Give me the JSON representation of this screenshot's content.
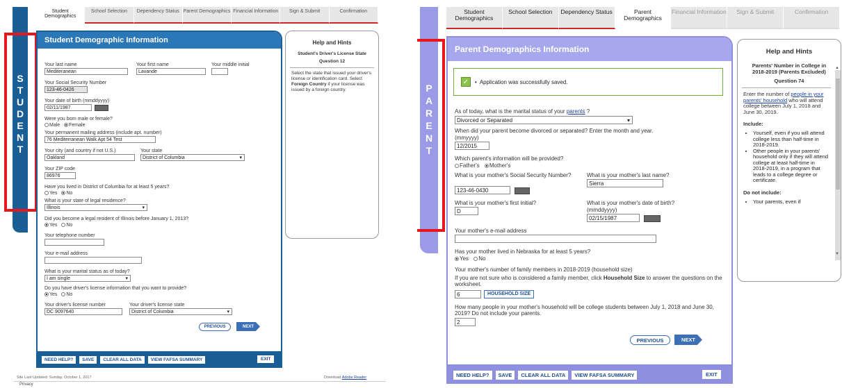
{
  "tabs": [
    "Student Demographics",
    "School Selection",
    "Dependency Status",
    "Parent Demographics",
    "Financial Information",
    "Sign & Submit",
    "Confirmation"
  ],
  "student": {
    "strip_letters": [
      "S",
      "T",
      "U",
      "D",
      "E",
      "N",
      "T"
    ],
    "panel_title": "Student Demographic Information",
    "last_name_label": "Your last name",
    "last_name": "Mediteranean",
    "first_name_label": "Your first name",
    "first_name": "Lavande",
    "mi_label": "Your middle initial",
    "ssn_label": "Your Social Security Number",
    "ssn": "123-46-0426",
    "dob_label": "Your date of birth (mmddyyyy)",
    "dob": "02/11/1987",
    "sex_label": "Were you born male or female?",
    "male": "Male",
    "female": "Female",
    "address_label": "Your permanent mailing address (include apt. number)",
    "address": "76 Mediterranean Walk Apt 54 Test",
    "city_label": "Your city (and country if not U.S.)",
    "city": "Oakland",
    "state_label": "Your state",
    "state": "District of Columbia",
    "zip_label": "Your ZIP code",
    "zip": "86976",
    "dc5_label": "Have you lived in District of Columbia for at least 5 years?",
    "yes": "Yes",
    "no": "No",
    "legal_res_label": "What is your state of legal residence?",
    "legal_res": "Illinois",
    "resident_2013_label": "Did you become a legal resident of Illinois before January 1, 2013?",
    "phone_label": "Your telephone number",
    "email_label": "Your e-mail address",
    "marital_label": "What is your marital status as of today?",
    "marital": "I am single",
    "dl_q_label": "Do you have driver's license information that you want to provide?",
    "dl_num_label": "Your driver's license number",
    "dl_num": "DC 9097640",
    "dl_state_label": "Your driver's license state",
    "dl_state": "District of Columbia",
    "previous": "PREVIOUS",
    "next": "NEXT",
    "footer_buttons": [
      "NEED HELP?",
      "SAVE",
      "CLEAR ALL DATA",
      "VIEW FAFSA SUMMARY"
    ],
    "exit": "EXIT",
    "site_updated": "Site Last Updated: Sunday, October 1, 2017",
    "download_text": "Download",
    "adobe_link": "Adobe Reader",
    "privacy": "Privacy",
    "help_title": "Help and Hints",
    "help_sub": "Student's Driver's License State",
    "help_q": "Question 12",
    "help_body_1": "Select the state that issued your driver's license or identification card. Select",
    "help_body_bold": "Foreign Country",
    "help_body_2": "if your license was issued by a foreign country."
  },
  "parent": {
    "strip_letters": [
      "P",
      "A",
      "R",
      "E",
      "N",
      "T"
    ],
    "panel_title": "Parent Demographics Information",
    "saved_msg": "Application was successfully saved.",
    "marital_q_pre": "As of today, what is the marital status of your",
    "marital_q_link": "parents",
    "marital_q_post": "?",
    "marital": "Divorced or Separated",
    "divorce_q": "When did your parent become divorced or separated? Enter the month and year.",
    "divorce_fmt": "(mmyyyy)",
    "divorce_date": "12/2015",
    "which_q": "Which parent's information will be provided?",
    "father": "Father's",
    "mother": "Mother's",
    "ssn_q": "What is your mother's Social Security Number?",
    "ssn": "123-46-0430",
    "last_q": "What is your mother's last name?",
    "last": "Sierra",
    "initial_q": "What is your mother's first initial?",
    "initial": "D",
    "dob_q": "What is your mother's date of birth?",
    "dob_fmt": "(mmddyyyy)",
    "dob": "02/15/1987",
    "email_q": "Your mother's e-mail address",
    "ne5_q": "Has your mother lived in Nebraska for at least 5 years?",
    "yes": "Yes",
    "no": "No",
    "family_q": "Your mother's number of family members in 2018-2019 (household size)",
    "family_help_pre": "If you are not sure who is considered a family member, click",
    "family_help_bold": "Household Size",
    "family_help_post": "to answer the questions on the worksheet.",
    "family_size": "6",
    "household_btn": "HOUSEHOLD SIZE",
    "college_q": "How many people in your mother's household will be college students between July 1, 2018 and June 30, 2019? Do not include your parents.",
    "college_count": "2",
    "previous": "PREVIOUS",
    "next": "NEXT",
    "footer_buttons": [
      "NEED HELP?",
      "SAVE",
      "CLEAR ALL DATA",
      "VIEW FAFSA SUMMARY"
    ],
    "exit": "EXIT",
    "help_title": "Help and Hints",
    "help_sub": "Parents' Number in College in 2018-2019 (Parents Excluded)",
    "help_q": "Question 74",
    "help_p1_pre": "Enter the number of",
    "help_p1_link": "people in your parents' household",
    "help_p1_post": "who will attend college between July 1, 2018 and June 30, 2019.",
    "include": "Include:",
    "inc_1": "Yourself, even if you will attend college less than half-time in 2018-2019.",
    "inc_2": "Other people in your parents' household only if they will attend college at least half-time in 2018-2019, in a program that leads to a college degree or certificate.",
    "exclude": "Do not include:",
    "exc_1": "Your parents, even if"
  },
  "colors": {
    "student_blue": "#1a5e96",
    "student_header": "#2b78b8",
    "parent_purple": "#8f8fe0",
    "parent_header": "#a7a7ee",
    "red_box": "#e8151b",
    "nav_blue": "#3c6fb6"
  }
}
